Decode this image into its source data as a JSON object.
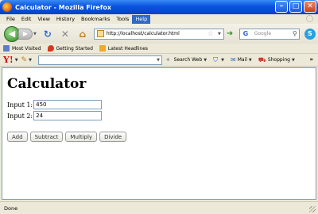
{
  "window": {
    "title": "Calculator - Mozilla Firefox"
  },
  "menu": [
    "File",
    "Edit",
    "View",
    "History",
    "Bookmarks",
    "Tools",
    "Help"
  ],
  "nav": {
    "url": "http://localhost/calculator.html",
    "search_placeholder": "Google"
  },
  "bookmarks": [
    "Most Visited",
    "Getting Started",
    "Latest Headlines"
  ],
  "yahoo": {
    "search_web": "Search Web",
    "mail": "Mail",
    "shopping": "Shopping",
    "more": "»"
  },
  "page": {
    "heading": "Calculator",
    "input1_label": "Input 1:",
    "input1_value": "450",
    "input2_label": "Input 2:",
    "input2_value": "24",
    "buttons": [
      "Add",
      "Subtract",
      "Multiply",
      "Divide"
    ]
  },
  "status": "Done"
}
